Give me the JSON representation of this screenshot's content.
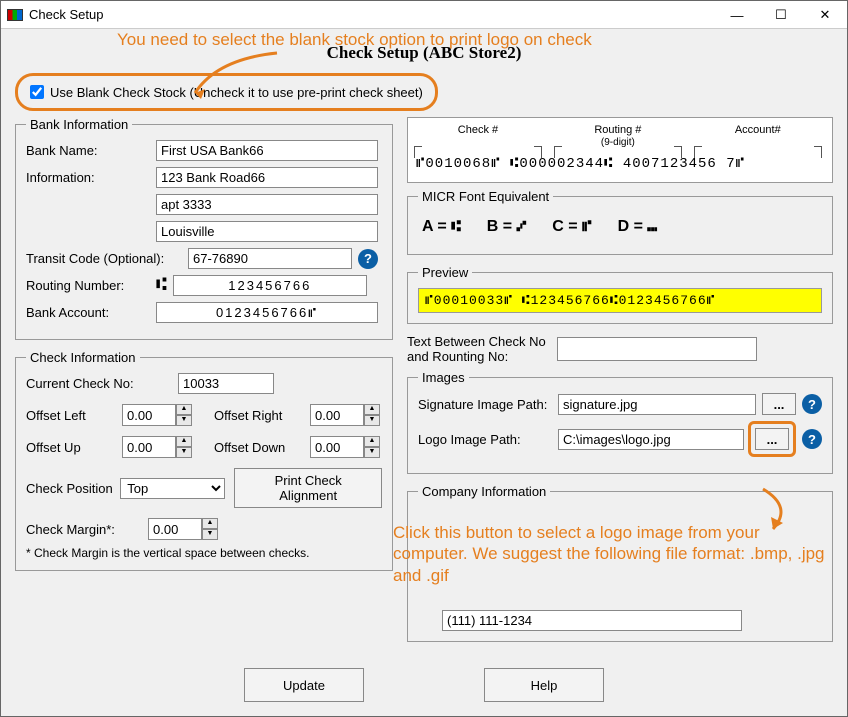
{
  "window": {
    "title": "Check Setup",
    "min": "—",
    "max": "☐",
    "close": "✕"
  },
  "annotations": {
    "top": "You need to select the blank stock option to print logo on check",
    "bottom": "Click this button to select a logo image from your computer. We suggest the following file format: .bmp, .jpg and .gif"
  },
  "dlg_title": "Check Setup (ABC Store2)",
  "blank_stock_label": "Use Blank Check Stock (Uncheck it to use pre-print check sheet)",
  "bank": {
    "legend": "Bank Information",
    "name_label": "Bank Name:",
    "name": "First USA Bank66",
    "info_label": "Information:",
    "addr1": "123 Bank Road66",
    "addr2": "apt 3333",
    "city": "Louisville",
    "transit_label": "Transit Code (Optional):",
    "transit": "67-76890",
    "routing_label": "Routing Number:",
    "routing_prefix": "⑆",
    "routing": "123456766",
    "account_label": "Bank Account:",
    "account": "0123456766⑈"
  },
  "check_info": {
    "legend": "Check Information",
    "current_no_label": "Current Check No:",
    "current_no": "10033",
    "offset_left_label": "Offset Left",
    "offset_left": "0.00",
    "offset_right_label": "Offset Right",
    "offset_right": "0.00",
    "offset_up_label": "Offset Up",
    "offset_up": "0.00",
    "offset_down_label": "Offset Down",
    "offset_down": "0.00",
    "position_label": "Check Position",
    "position": "Top",
    "align_btn": "Print Check Alignment",
    "margin_label": "Check Margin*:",
    "margin": "0.00",
    "margin_note": "* Check Margin is the vertical space between checks."
  },
  "micr_sample": {
    "check_hdr": "Check #",
    "routing_hdr": "Routing #",
    "routing_sub": "(9-digit)",
    "account_hdr": "Account#",
    "line": "⑈0010068⑈ ⑆000002344⑆ 4007123456 7⑈"
  },
  "micr_eq": {
    "legend": "MICR Font Equivalent",
    "a": "A  =  ⑆",
    "b": "B  =  ⑇",
    "c": "C  =  ⑈",
    "d": "D  =  ⑉"
  },
  "preview": {
    "legend": "Preview",
    "line": "⑈00010033⑈ ⑆123456766⑆0123456766⑈"
  },
  "text_between": {
    "label": "Text Between Check No and Rounting No:",
    "value": ""
  },
  "images": {
    "legend": "Images",
    "sig_label": "Signature Image Path:",
    "sig_path": "signature.jpg",
    "logo_label": "Logo Image Path:",
    "logo_path": "C:\\images\\logo.jpg",
    "browse": "..."
  },
  "company": {
    "legend": "Company Information",
    "phone": "(111) 111-1234"
  },
  "buttons": {
    "update": "Update",
    "help": "Help",
    "help_q": "?"
  }
}
